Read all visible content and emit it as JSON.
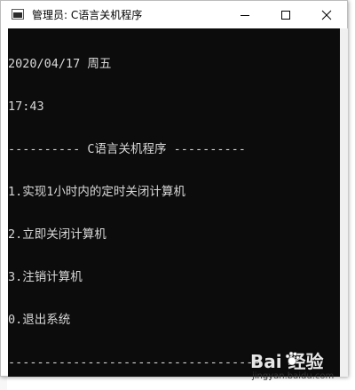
{
  "window": {
    "title": "管理员:  C语言关机程序",
    "controls": {
      "minimize_icon": "minimize-icon",
      "maximize_icon": "maximize-icon",
      "close_icon": "close-icon"
    }
  },
  "console": {
    "lines": [
      "2020/04/17 周五",
      "17:43",
      "---------- C语言关机程序 ----------",
      "1.实现1小时内的定时关闭计算机",
      "2.立即关闭计算机",
      "3.注销计算机",
      "0.退出系统",
      "-----------------------------------"
    ]
  },
  "watermark": {
    "logo_text": "Bai  经验",
    "url": "jingyan.baidu.com"
  },
  "colors": {
    "console_bg": "#0c0c0c",
    "console_fg": "#d8d8d8",
    "titlebar_bg": "#ffffff"
  }
}
